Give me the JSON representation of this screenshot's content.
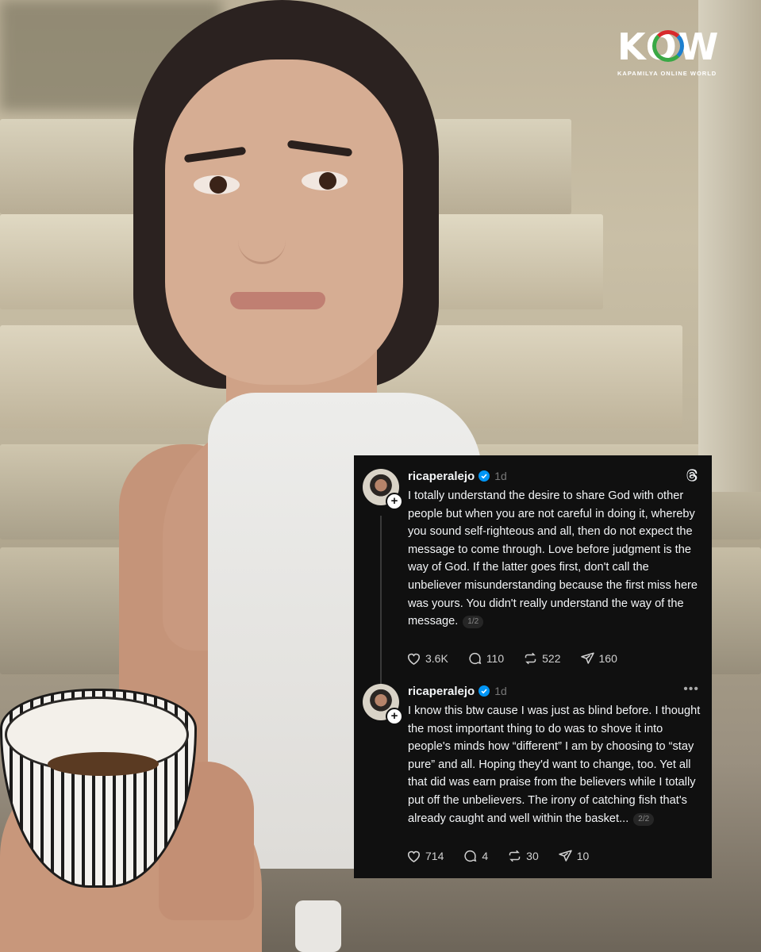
{
  "logo": {
    "wordmark": "KOW",
    "tagline": "KAPAMILYA ONLINE WORLD"
  },
  "posts": [
    {
      "username": "ricaperalejo",
      "time": "1d",
      "header_icon": "threads-logo-icon",
      "text": "I totally understand the desire to share God with other people but when you are not careful in doing it, whereby you sound self-righteous and all, then do not expect the message to come through. Love before judgment is the way of God. If the latter goes first, don't call the unbeliever misunderstanding because the first miss here was yours. You didn't really understand the way of the message.",
      "thread_count": "1/2",
      "likes": "3.6K",
      "replies": "110",
      "reposts": "522",
      "shares": "160"
    },
    {
      "username": "ricaperalejo",
      "time": "1d",
      "header_icon": "more-options-icon",
      "text": "I know this btw cause I was just as blind before. I thought the most important thing to do was to shove it into people's minds how “different” I am by choosing to “stay pure” and all. Hoping they'd want to change, too. Yet all that did was earn praise from the believers while I totally put off the unbelievers. The irony of catching fish that's already caught and well within the basket...",
      "thread_count": "2/2",
      "likes": "714",
      "replies": "4",
      "reposts": "30",
      "shares": "10"
    }
  ],
  "colors": {
    "card_background": "#101010",
    "verified_badge": "#0095f6",
    "text_primary": "#f3f5f7",
    "text_muted": "#777777"
  }
}
